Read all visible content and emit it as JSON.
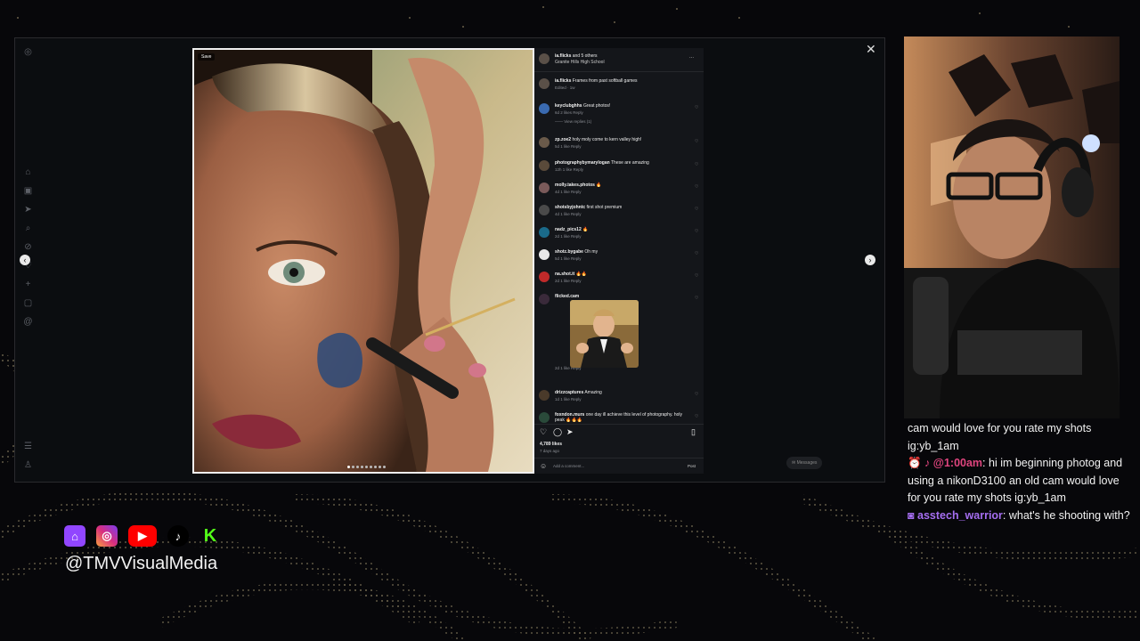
{
  "post": {
    "save_label": "Save",
    "header_user": "ia.flicks",
    "header_rest": " and 5 others",
    "location": "Granite Hills High School",
    "more": "···",
    "caption_user": "ia.flicks",
    "caption_text": " Frames from past softball games",
    "caption_meta": "Edited · 1w"
  },
  "comments": [
    {
      "user": "keyclubghhs",
      "text": " Great photos!",
      "meta": "6d   2 likes   Reply",
      "view": "View replies (1)"
    },
    {
      "user": "zp.zoe2",
      "text": " holy moly come to kern valley high!",
      "meta": "5d   1 like   Reply"
    },
    {
      "user": "photographybymarylogan",
      "text": " These are amazing",
      "meta": "12h   1 like   Reply"
    },
    {
      "user": "molly.takes.photos",
      "text": " 🔥",
      "meta": "4d   1 like   Reply"
    },
    {
      "user": "shotsbyjohntc",
      "text": " first shot premium",
      "meta": "4d   1 like   Reply"
    },
    {
      "user": "nadz_pics12",
      "text": " 🔥",
      "meta": "2d   1 like   Reply"
    },
    {
      "user": "shotz.bygabe",
      "text": " Oh my",
      "meta": "5d   1 like   Reply"
    },
    {
      "user": "na.shot.it",
      "text": " 🔥🔥",
      "meta": "2d   1 like   Reply"
    },
    {
      "user": "flicked.cam",
      "text": "",
      "meta": "2d   1 like   Reply"
    },
    {
      "user": "drizzcaptures",
      "text": " Amazing",
      "meta": "1d   1 like   Reply"
    },
    {
      "user": "foxndon.murs",
      "text": " one day ill achieve this level of photography. holy peak 🔥🔥🔥",
      "meta": ""
    }
  ],
  "stats": {
    "likes": "4,789 likes",
    "age": "7 days ago"
  },
  "composer": {
    "placeholder": "Add a comment...",
    "post": "Post"
  },
  "messages_label": "Messages",
  "close": "✕",
  "nav": {
    "prev": "‹",
    "next": "›"
  },
  "chat": {
    "line1": "cam would love for you rate my shots ig:yb_1am",
    "u1": "@1:00am",
    "m1": ": hi im beginning photog and using a nikonD3100 an old cam would love for you rate my shots ig:yb_1am",
    "u2": "asstech_warrior",
    "m2": ": what's he shooting with?"
  },
  "branding": {
    "handle": "@TMVVisualMedia"
  },
  "colors": {
    "accent_pink": "#e0457e",
    "accent_purple": "#a56ef0"
  }
}
